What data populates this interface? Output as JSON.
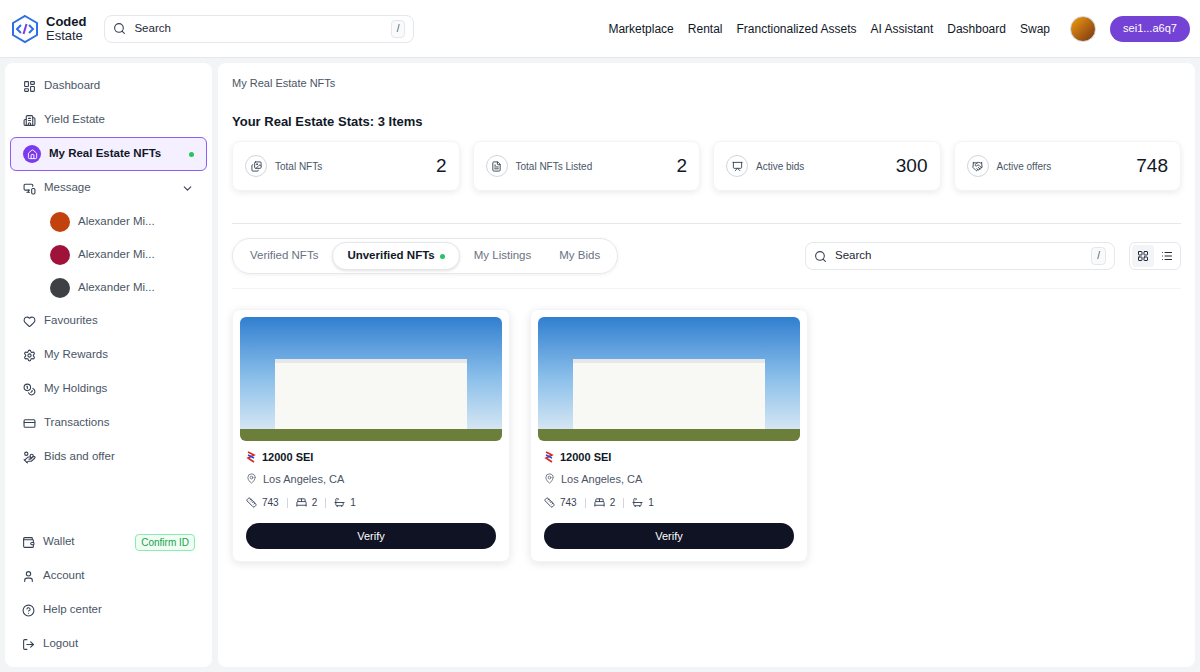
{
  "header": {
    "logo": {
      "line1": "Coded",
      "line2": "Estate"
    },
    "search": {
      "placeholder": "Search",
      "shortcut": "/"
    },
    "nav": [
      "Marketplace",
      "Rental",
      "Franctionalized Assets",
      "AI Assistant",
      "Dashboard",
      "Swap"
    ],
    "wallet": "sei1...a6q7"
  },
  "sidebar": {
    "items": [
      {
        "kind": "link",
        "label": "Dashboard",
        "selected": false,
        "dot": false
      },
      {
        "kind": "link",
        "label": "Yield Estate",
        "selected": false,
        "dot": false
      },
      {
        "kind": "link",
        "label": "My Real Estate NFTs",
        "selected": true,
        "dot": true
      },
      {
        "kind": "group",
        "label": "Message",
        "selected": false,
        "dot": false,
        "expanded": true,
        "children": [
          "Alexander Mi...",
          "Alexander Mi...",
          "Alexander Mi..."
        ]
      },
      {
        "kind": "link",
        "label": "Favourites",
        "selected": false,
        "dot": false
      },
      {
        "kind": "link",
        "label": "My Rewards",
        "selected": false,
        "dot": false
      },
      {
        "kind": "link",
        "label": "My Holdings",
        "selected": false,
        "dot": false
      },
      {
        "kind": "link",
        "label": "Transactions",
        "selected": false,
        "dot": false
      },
      {
        "kind": "link",
        "label": "Bids and offer",
        "selected": false,
        "dot": false
      }
    ],
    "bottom": [
      {
        "label": "Wallet",
        "badge": "Confirm ID"
      },
      {
        "label": "Account",
        "badge": ""
      },
      {
        "label": "Help center",
        "badge": ""
      },
      {
        "label": "Logout",
        "badge": ""
      }
    ]
  },
  "main": {
    "breadcrumb": "My Real Estate NFTs",
    "title": "Your Real Estate Stats: 3 Items",
    "stats": [
      {
        "label": "Total NFTs",
        "value": "2"
      },
      {
        "label": "Total NFTs Listed",
        "value": "2"
      },
      {
        "label": "Active bids",
        "value": "300"
      },
      {
        "label": "Active offers",
        "value": "748"
      }
    ],
    "tabs": [
      {
        "label": "Verified NFTs",
        "selected": false,
        "dot": false
      },
      {
        "label": "Unverified NFTs",
        "selected": true,
        "dot": true
      },
      {
        "label": "My Listings",
        "selected": false,
        "dot": false
      },
      {
        "label": "My Bids",
        "selected": false,
        "dot": false
      }
    ],
    "search": {
      "placeholder": "Search",
      "shortcut": "/"
    },
    "views": [
      {
        "kind": "grid",
        "selected": true
      },
      {
        "kind": "list",
        "selected": false
      }
    ],
    "cards": [
      {
        "price": "12000 SEI",
        "location": "Los Angeles, CA",
        "area": "743",
        "beds": "2",
        "baths": "1",
        "button": "Verify"
      },
      {
        "price": "12000 SEI",
        "location": "Los Angeles, CA",
        "area": "743",
        "beds": "2",
        "baths": "1",
        "button": "Verify"
      }
    ]
  }
}
